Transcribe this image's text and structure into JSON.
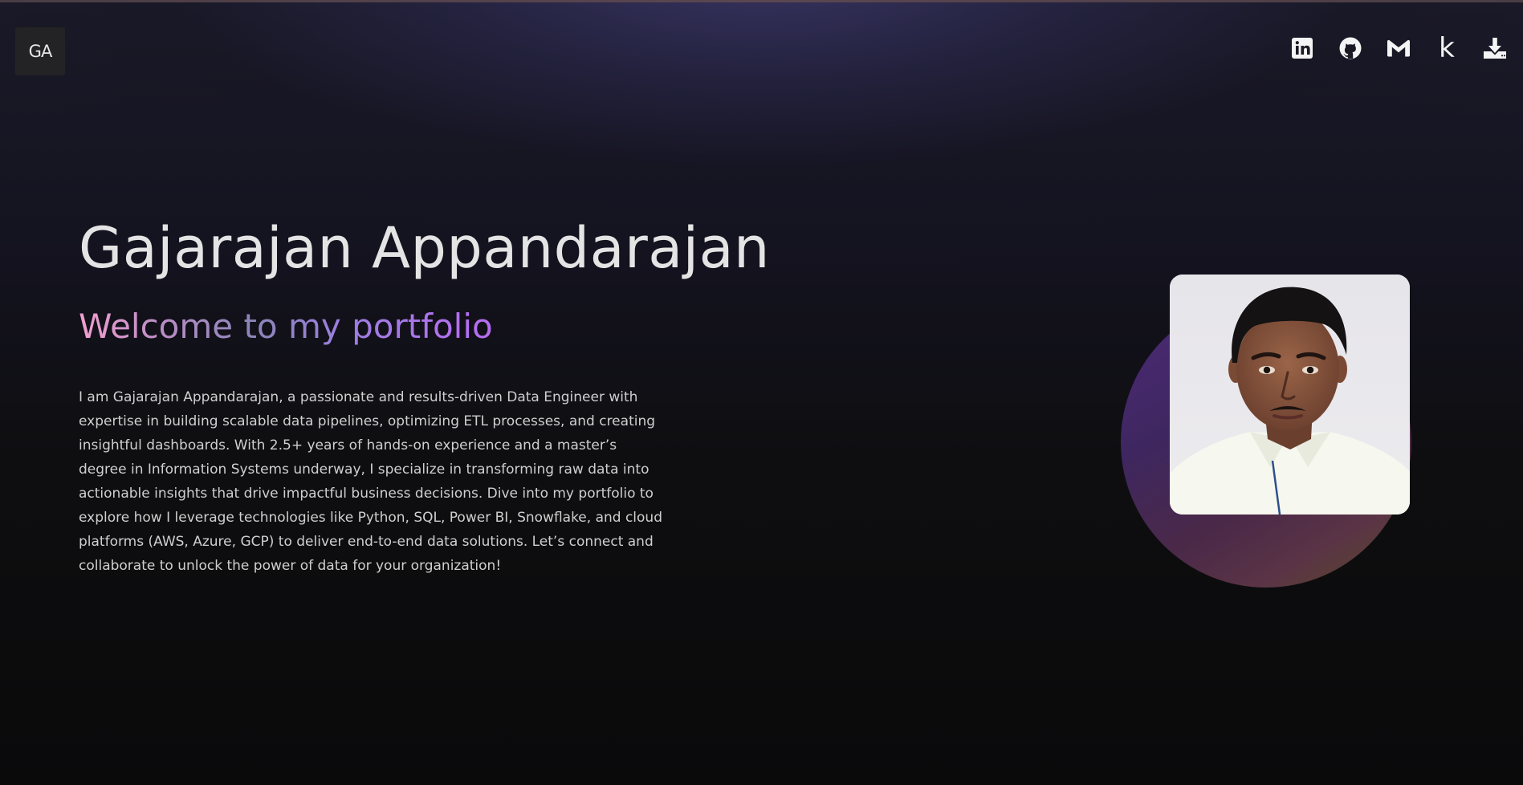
{
  "header": {
    "logo_text": "GA",
    "icons": [
      {
        "name": "linkedin-icon",
        "label": "LinkedIn"
      },
      {
        "name": "github-icon",
        "label": "GitHub"
      },
      {
        "name": "gmail-icon",
        "label": "Gmail"
      },
      {
        "name": "kaggle-icon",
        "label": "Kaggle",
        "glyph": "k"
      },
      {
        "name": "download-icon",
        "label": "Download Resume"
      }
    ]
  },
  "hero": {
    "name": "Gajarajan Appandarajan",
    "tagline": "Welcome to my portfolio",
    "bio": "I am Gajarajan Appandarajan, a passionate and results-driven Data Engineer with expertise in building scalable data pipelines, optimizing ETL processes, and creating insightful dashboards. With 2.5+ years of hands-on experience and a master’s degree in Information Systems underway, I specialize in transforming raw data into actionable insights that drive impactful business decisions. Dive into my portfolio to explore how I leverage technologies like Python, SQL, Power BI, Snowflake, and cloud platforms (AWS, Azure, GCP) to deliver end-to-end data solutions. Let’s connect and collaborate to unlock the power of data for your organization!",
    "photo_alt": "Gajarajan Appandarajan"
  },
  "colors": {
    "background": "#0c0c0e",
    "name_text": "#e4e4e4",
    "tagline_gradient_start": "#f29fd0",
    "tagline_gradient_end": "#b86cf2",
    "icon": "#f4f4f4"
  }
}
